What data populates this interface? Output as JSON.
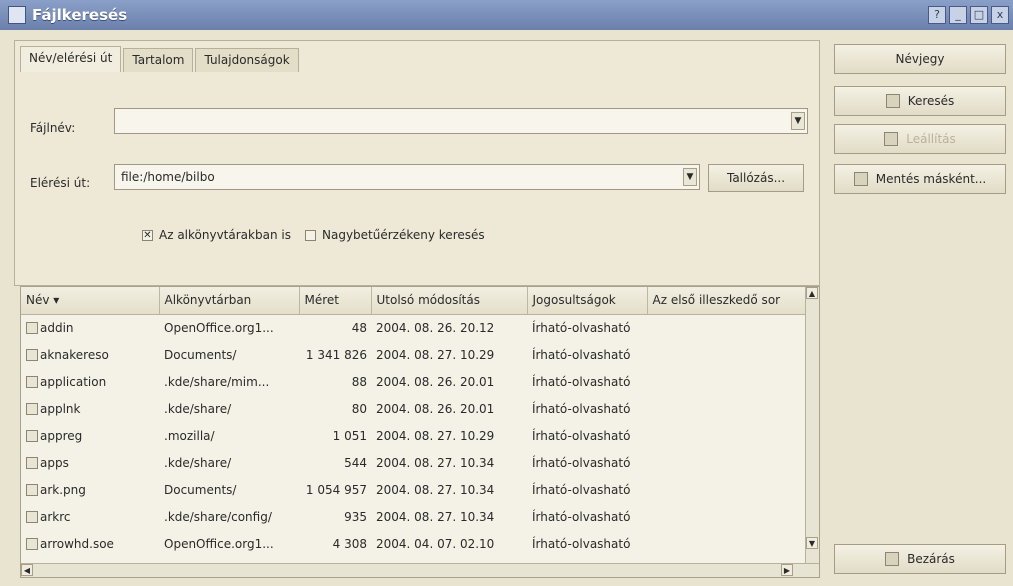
{
  "window": {
    "title": "Fájlkeresés",
    "controls": [
      "?",
      "_",
      "□",
      "x"
    ]
  },
  "tabs": [
    "Név/elérési út",
    "Tartalom",
    "Tulajdonságok"
  ],
  "fields": {
    "filename_label": "Fájlnév:",
    "filename_value": "",
    "path_label": "Elérési út:",
    "path_value": "file:/home/bilbo",
    "browse_label": "Tallózás...",
    "subdirs_label": "Az alkönyvtárakban is",
    "case_label": "Nagybetűérzékeny keresés"
  },
  "right_buttons": {
    "about": "Névjegy",
    "search": "Keresés",
    "stop": "Leállítás",
    "save_as": "Mentés másként...",
    "close": "Bezárás"
  },
  "table": {
    "columns": [
      "Név",
      "Alkönyvtárban",
      "Méret",
      "Utolsó módosítás",
      "Jogosultságok",
      "Az első illeszkedő sor"
    ],
    "rows": [
      {
        "name": "addin",
        "dir": "OpenOffice.org1...",
        "size": "48",
        "modified": "2004. 08. 26. 20.12",
        "perms": "Írható-olvasható"
      },
      {
        "name": "aknakereso",
        "dir": "Documents/",
        "size": "1 341 826",
        "modified": "2004. 08. 27. 10.29",
        "perms": "Írható-olvasható"
      },
      {
        "name": "application",
        "dir": ".kde/share/mim...",
        "size": "88",
        "modified": "2004. 08. 26. 20.01",
        "perms": "Írható-olvasható"
      },
      {
        "name": "applnk",
        "dir": ".kde/share/",
        "size": "80",
        "modified": "2004. 08. 26. 20.01",
        "perms": "Írható-olvasható"
      },
      {
        "name": "appreg",
        "dir": ".mozilla/",
        "size": "1 051",
        "modified": "2004. 08. 27. 10.29",
        "perms": "Írható-olvasható"
      },
      {
        "name": "apps",
        "dir": ".kde/share/",
        "size": "544",
        "modified": "2004. 08. 27. 10.34",
        "perms": "Írható-olvasható"
      },
      {
        "name": "ark.png",
        "dir": "Documents/",
        "size": "1 054 957",
        "modified": "2004. 08. 27. 10.34",
        "perms": "Írható-olvasható"
      },
      {
        "name": "arkrc",
        "dir": ".kde/share/config/",
        "size": "935",
        "modified": "2004. 08. 27. 10.34",
        "perms": "Írható-olvasható"
      },
      {
        "name": "arrowhd.soe",
        "dir": "OpenOffice.org1...",
        "size": "4 308",
        "modified": "2004. 04. 07. 02.10",
        "perms": "Írható-olvasható"
      }
    ]
  }
}
